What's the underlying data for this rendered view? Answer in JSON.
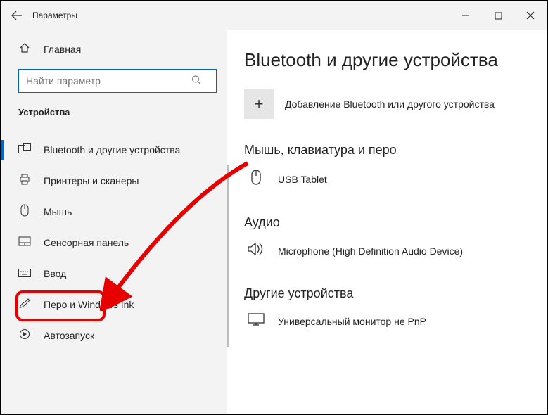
{
  "window": {
    "title": "Параметры"
  },
  "sidebar": {
    "home": "Главная",
    "search_placeholder": "Найти параметр",
    "category": "Устройства",
    "items": [
      {
        "icon": "devices",
        "label": "Bluetooth и другие устройства",
        "active": true
      },
      {
        "icon": "printer",
        "label": "Принтеры и сканеры"
      },
      {
        "icon": "mouse",
        "label": "Мышь"
      },
      {
        "icon": "touchpad",
        "label": "Сенсорная панель"
      },
      {
        "icon": "keyboard",
        "label": "Ввод"
      },
      {
        "icon": "pen",
        "label": "Перо и Windows Ink"
      },
      {
        "icon": "autoplay",
        "label": "Автозапуск"
      }
    ]
  },
  "content": {
    "heading": "Bluetooth и другие устройства",
    "add_label": "Добавление Bluetooth или другого устройства",
    "sections": [
      {
        "title": "Мышь, клавиатура и перо",
        "device": "USB Tablet",
        "icon": "mouse"
      },
      {
        "title": "Аудио",
        "device": "Microphone (High Definition Audio Device)",
        "icon": "audio"
      },
      {
        "title": "Другие устройства",
        "device": "Универсальный монитор не PnP",
        "icon": "monitor"
      }
    ]
  }
}
